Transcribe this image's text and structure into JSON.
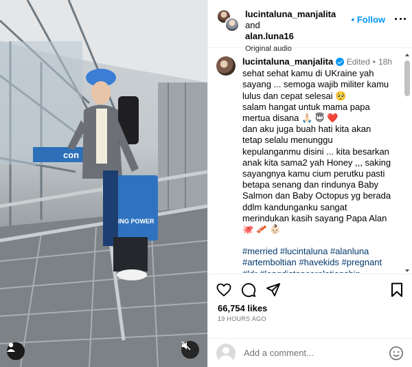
{
  "media": {
    "sign_text": "con",
    "bag_text": "KING POWER",
    "user_tag_icon": "person-icon",
    "mute_icon": "speaker-muted-icon"
  },
  "header": {
    "user1": "lucintaluna_manjalita",
    "and_word": "and",
    "user2": "alan.luna16",
    "audio": "Original audio",
    "follow_label": "• Follow",
    "more_icon": "more-horizontal-icon"
  },
  "caption": {
    "username": "lucintaluna_manjalita",
    "edited": "Edited",
    "separator": "•",
    "time": "18h",
    "text": "sehat sehat kamu di UKraine yah sayang ... semoga wajib militer kamu lulus dan cepat selesai 🥺\nsalam hangat untuk mama papa mertua disana 🙏🏻 😇 ❤️\ndan aku juga buah hati kita akan tetap selalu menunggu kepulanganmu disini ... kita besarkan anak kita sama2 yah Honey ,,, saking sayangnya kamu cium perutku pasti betapa senang dan rindunya Baby Salmon dan Baby Octopus yg berada ddlm kandunganku sangat merindukan kasih sayang Papa Alan 🐙 🥓 👶🏻",
    "hashtags": "#merried #lucintaluna #alanluna #artembolt​ian #havekids #pregnant #ldr #longdistancerelationship #husbandandwife"
  },
  "actions": {
    "like_icon": "heart-icon",
    "comment_icon": "comment-icon",
    "share_icon": "paper-plane-icon",
    "save_icon": "bookmark-icon",
    "likes": "66,754 likes",
    "timestamp": "19 HOURS AGO"
  },
  "comment": {
    "placeholder": "Add a comment...",
    "emoji_icon": "smiley-icon"
  }
}
